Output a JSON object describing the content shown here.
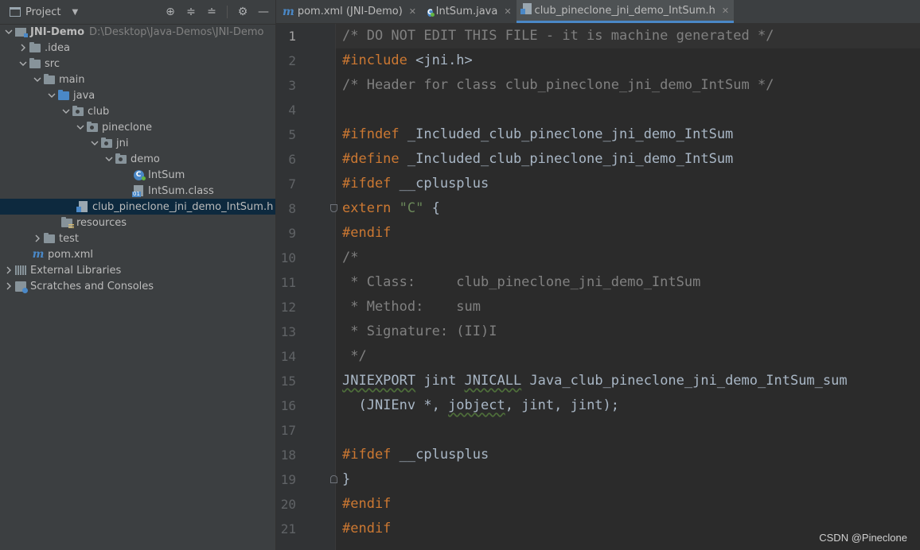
{
  "project_panel": {
    "title": "Project",
    "tools": [
      "locate-icon",
      "expand-all-icon",
      "collapse-all-icon",
      "gear-icon",
      "minimize-icon"
    ],
    "tree": [
      {
        "label": "JNI-Demo",
        "path": "D:\\Desktop\\Java-Demos\\JNI-Demo"
      },
      {
        "label": ".idea"
      },
      {
        "label": "src"
      },
      {
        "label": "main"
      },
      {
        "label": "java"
      },
      {
        "label": "club"
      },
      {
        "label": "pineclone"
      },
      {
        "label": "jni"
      },
      {
        "label": "demo"
      },
      {
        "label": "IntSum"
      },
      {
        "label": "IntSum.class"
      },
      {
        "label": "club_pineclone_jni_demo_IntSum.h"
      },
      {
        "label": "resources"
      },
      {
        "label": "test"
      },
      {
        "label": "pom.xml"
      },
      {
        "label": "External Libraries"
      },
      {
        "label": "Scratches and Consoles"
      }
    ]
  },
  "tabs": [
    {
      "label": "pom.xml (JNI-Demo)",
      "icon": "maven-icon"
    },
    {
      "label": "IntSum.java",
      "icon": "class-icon"
    },
    {
      "label": "club_pineclone_jni_demo_IntSum.h",
      "icon": "header-file-icon"
    }
  ],
  "editor": {
    "line_numbers": [
      "1",
      "2",
      "3",
      "4",
      "5",
      "6",
      "7",
      "8",
      "9",
      "10",
      "11",
      "12",
      "13",
      "14",
      "15",
      "16",
      "17",
      "18",
      "19",
      "20",
      "21"
    ],
    "lines": {
      "l1": "/* DO NOT EDIT THIS FILE - it is machine generated */",
      "l2_kw": "#include",
      "l2_rest": " <jni.h>",
      "l3": "/* Header for class club_pineclone_jni_demo_IntSum */",
      "l5_kw": "#ifndef",
      "l5_rest": " _Included_club_pineclone_jni_demo_IntSum",
      "l6_kw": "#define",
      "l6_rest": " _Included_club_pineclone_jni_demo_IntSum",
      "l7_kw": "#ifdef",
      "l7_rest": " __cplusplus",
      "l8_kw": "extern",
      "l8_str": "\"C\"",
      "l8_rest": " {",
      "l9": "#endif",
      "l10": "/*",
      "l11": " * Class:     club_pineclone_jni_demo_IntSum",
      "l12": " * Method:    sum",
      "l13": " * Signature: (II)I",
      "l14": " */",
      "l15_a": "JNIEXPORT",
      "l15_b": " jint ",
      "l15_c": "JNICALL",
      "l15_d": " Java_club_pineclone_jni_demo_IntSum_sum",
      "l16_a": "  (JNIEnv *, ",
      "l16_b": "jobject",
      "l16_c": ", jint, jint);",
      "l18_kw": "#ifdef",
      "l18_rest": " __cplusplus",
      "l19": "}",
      "l20": "#endif",
      "l21": "#endif"
    }
  },
  "watermark": "CSDN @Pineclone"
}
